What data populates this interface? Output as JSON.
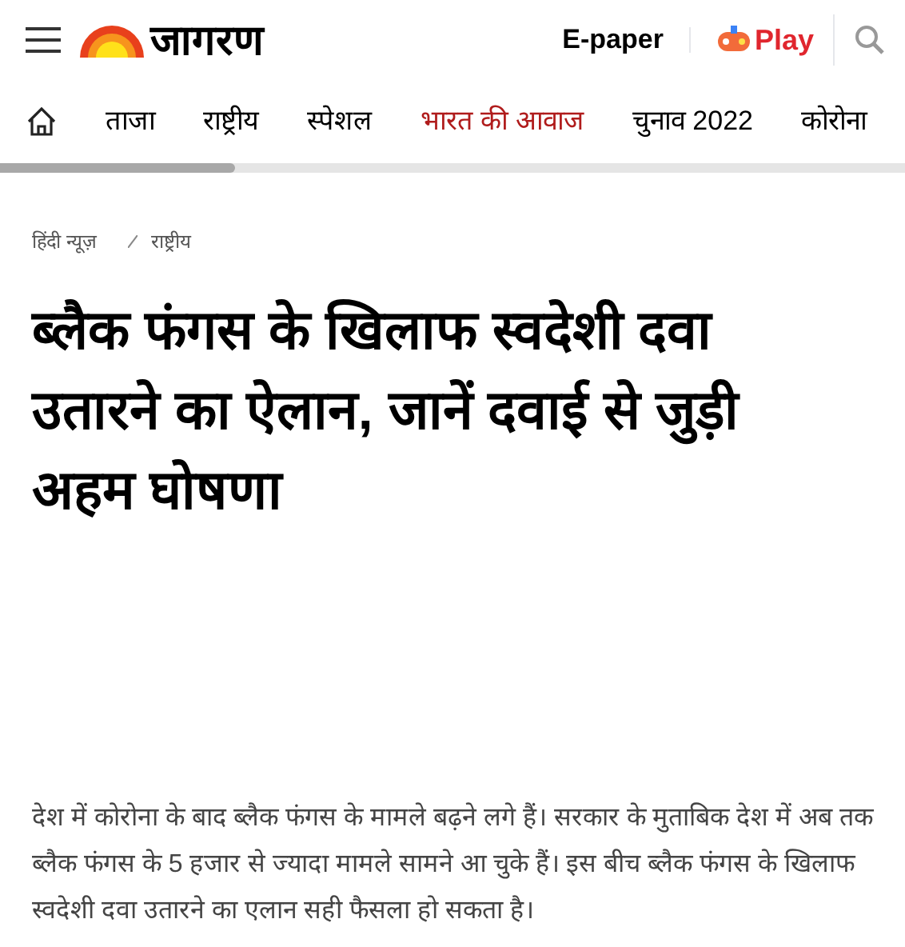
{
  "header": {
    "logo": "जागरण",
    "epaper": "E-paper",
    "play": "Play"
  },
  "nav": [
    {
      "label": "ताजा",
      "selected": false
    },
    {
      "label": "राष्ट्रीय",
      "selected": false
    },
    {
      "label": "स्पेशल",
      "selected": false
    },
    {
      "label": "भारत की आवाज",
      "selected": true
    },
    {
      "label": "चुनाव 2022",
      "selected": false
    },
    {
      "label": "कोरोना",
      "selected": false
    }
  ],
  "breadcrumb": [
    "हिंदी न्यूज़",
    "राष्ट्रीय"
  ],
  "headline": "ब्लैक फंगस के खिलाफ स्वदेशी दवा उतारने का ऐलान, जानें दवाई से जुड़ी अहम घोषणा",
  "summary": "देश में कोरोना के बाद ब्लैक फंगस के मामले बढ़ने लगे हैं। सरकार के मुताबिक देश में अब तक ब्लैक फंगस के 5 हजार से ज्यादा मामले सामने आ चुके हैं। इस बीच ब्लैक फंगस के खिलाफ स्वदेशी दवा उतारने का एलान सही फैसला हो सकता है।"
}
